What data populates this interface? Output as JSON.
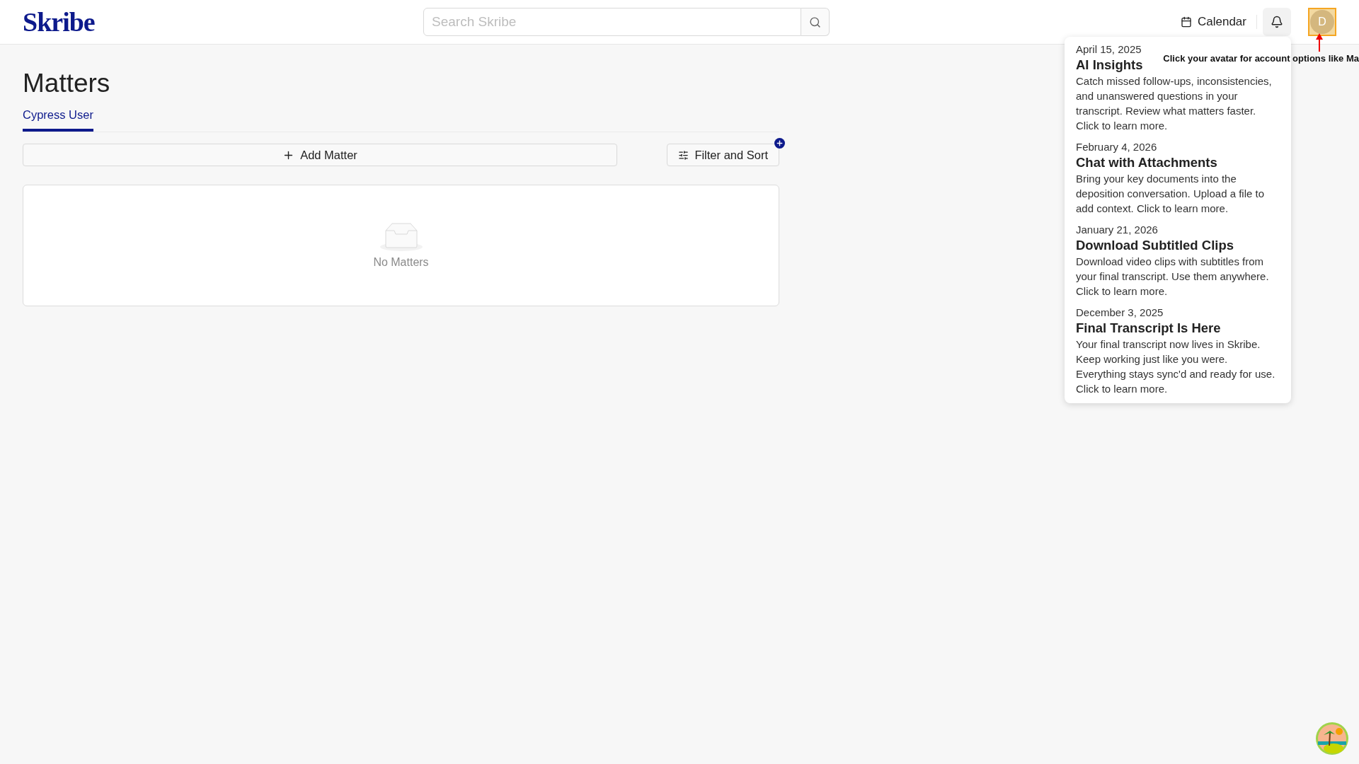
{
  "header": {
    "logo": "Skribe",
    "search": {
      "placeholder": "Search Skribe"
    },
    "calendar": "Calendar",
    "avatar": "D"
  },
  "whats_new": [
    {
      "date": "April 15, 2025",
      "title": "AI Insights",
      "body": "Catch missed follow-ups, inconsistencies, and unanswered questions in your transcript. Review what matters faster. Click to learn more."
    },
    {
      "date": "February 4, 2026",
      "title": "Chat with Attachments",
      "body": "Bring your key documents into the deposition conversation. Upload a file to add context. Click to learn more."
    },
    {
      "date": "January 21, 2026",
      "title": "Download Subtitled Clips",
      "body": "Download video clips with subtitles from your final transcript. Use them anywhere. Click to learn more."
    },
    {
      "date": "December 3, 2025",
      "title": "Final Transcript Is Here",
      "body": "Your final transcript now lives in Skribe. Keep working just like you were. Everything stays sync'd and ready for use. Click to learn more."
    }
  ],
  "tour_hint": "Click your avatar for account options like Ma",
  "page": {
    "title": "Matters",
    "tabs": [
      {
        "label": "Cypress User",
        "selected": true
      }
    ],
    "add_button": "Add Matter",
    "filter_button": "Filter and Sort",
    "empty_text": "No Matters"
  }
}
